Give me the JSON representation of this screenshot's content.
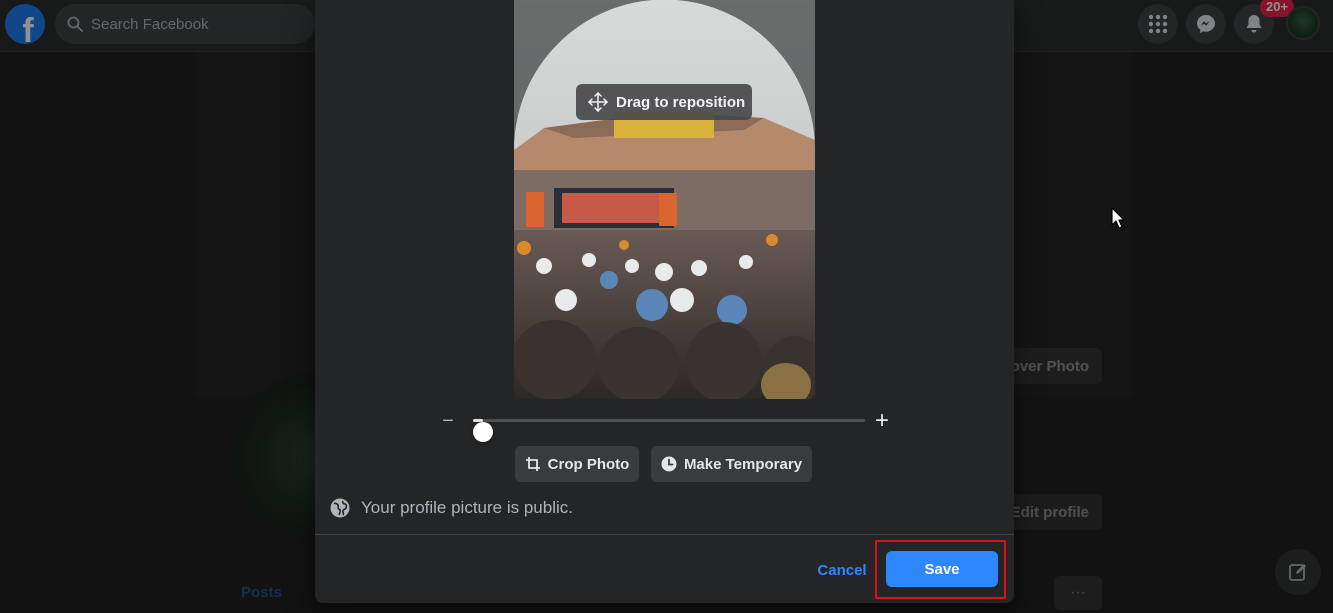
{
  "topbar": {
    "logo_letter": "f",
    "search_placeholder": "Search Facebook",
    "notifications_badge": "20+",
    "icons": [
      "facebook-logo-icon",
      "search-icon",
      "menu-grid-icon",
      "messenger-icon",
      "bell-icon"
    ]
  },
  "profile": {
    "cover_button_label": "over Photo",
    "edit_profile_label": "Edit profile",
    "posts_tab_label": "Posts",
    "more_label": "···"
  },
  "modal": {
    "drag_label": "Drag to reposition",
    "zoom": {
      "minus_label": "−",
      "plus_label": "+",
      "value": 0
    },
    "crop_label": "Crop Photo",
    "temporary_label": "Make Temporary",
    "privacy_text": "Your profile picture is public.",
    "cancel_label": "Cancel",
    "save_label": "Save"
  },
  "colors": {
    "accent": "#2d88ff",
    "highlight_border": "#e0101a",
    "modal_bg": "#242526",
    "badge": "#e41e3f"
  }
}
